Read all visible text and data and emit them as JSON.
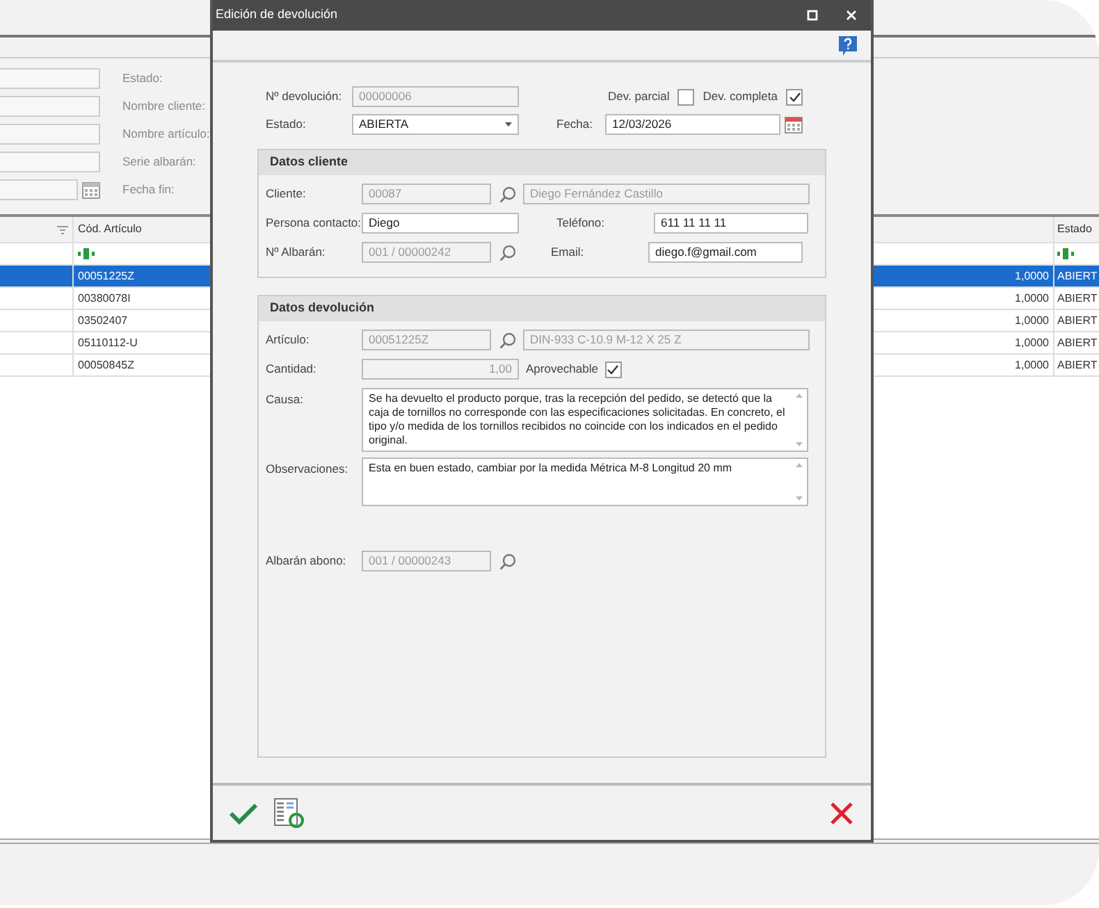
{
  "background": {
    "filters": [
      {
        "label": "Estado:",
        "kind": "text"
      },
      {
        "label": "Nombre cliente:",
        "kind": "text"
      },
      {
        "label": "Nombre artículo:",
        "kind": "text"
      },
      {
        "label": "Serie albarán:",
        "kind": "text"
      },
      {
        "label": "Fecha fin:",
        "kind": "date"
      }
    ],
    "grid": {
      "columns": {
        "code": "Cód. Artículo",
        "status": "Estado"
      },
      "rows": [
        {
          "code": "00051225Z",
          "quantity": "1,0000",
          "status": "ABIERT",
          "selected": true
        },
        {
          "code": "00380078I",
          "quantity": "1,0000",
          "status": "ABIERT",
          "selected": false
        },
        {
          "code": "03502407",
          "quantity": "1,0000",
          "status": "ABIERT",
          "selected": false
        },
        {
          "code": "05110112-U",
          "quantity": "1,0000",
          "status": "ABIERT",
          "selected": false
        },
        {
          "code": "00050845Z",
          "quantity": "1,0000",
          "status": "ABIERT",
          "selected": false
        }
      ]
    }
  },
  "dialog": {
    "title": "Edición de devolución",
    "numero": {
      "label": "Nº devolución:",
      "value": "00000006",
      "disabled": true
    },
    "dev_parcial": {
      "label": "Dev. parcial",
      "checked": false
    },
    "dev_completa": {
      "label": "Dev. completa",
      "checked": true
    },
    "estado": {
      "label": "Estado:",
      "value": "ABIERTA"
    },
    "fecha": {
      "label": "Fecha:",
      "value": "12/03/2026",
      "disabled": false
    },
    "datos_cliente": {
      "title": "Datos cliente",
      "cliente": {
        "label": "Cliente:",
        "code": "00087",
        "name": "Diego Fernández Castillo",
        "disabled": true
      },
      "persona_contacto": {
        "label": "Persona contacto:",
        "value": "Diego",
        "disabled": false
      },
      "telefono": {
        "label": "Teléfono:",
        "value": "611 11 11 11",
        "disabled": false
      },
      "albaran": {
        "label": "Nº Albarán:",
        "value": "001 / 00000242",
        "disabled": true
      },
      "email": {
        "label": "Email:",
        "value": "diego.f@gmail.com",
        "disabled": false
      }
    },
    "datos_devolucion": {
      "title": "Datos devolución",
      "articulo": {
        "label": "Artículo:",
        "code": "00051225Z",
        "description": "DIN-933 C-10.9 M-12 X 25 Z",
        "disabled": true
      },
      "cantidad": {
        "label": "Cantidad:",
        "value": "1,00",
        "disabled": true
      },
      "aprovechable": {
        "label": "Aprovechable",
        "checked": true
      },
      "causa": {
        "label": "Causa:",
        "value": "Se ha devuelto el producto porque, tras la recepción del pedido, se detectó que la caja de tornillos no corresponde con las especificaciones solicitadas. En concreto, el tipo y/o medida de los tornillos recibidos no coincide con los indicados en el pedido original."
      },
      "observaciones": {
        "label": "Observaciones:",
        "value": "Esta en buen estado, cambiar por la medida Métrica M-8 Longitud 20 mm"
      },
      "albaran_abono": {
        "label": "Albarán abono:",
        "value": "001 / 00000243",
        "disabled": true
      }
    }
  }
}
